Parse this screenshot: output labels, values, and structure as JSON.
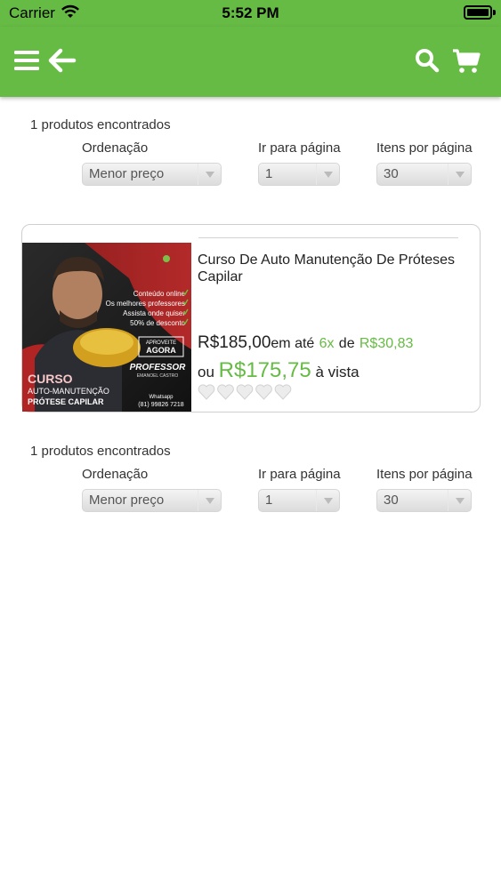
{
  "status_bar": {
    "carrier": "Carrier",
    "time": "5:52 PM"
  },
  "nav": {
    "icons": [
      "menu-icon",
      "back-arrow-icon",
      "search-icon",
      "cart-icon"
    ],
    "color": "#66bb44"
  },
  "top_controls": {
    "results": "1 produtos encontrados",
    "sort_label": "Ordenação",
    "sort_value": "Menor preço",
    "page_label": "Ir para página",
    "page_value": "1",
    "per_page_label": "Itens por página",
    "per_page_value": "30"
  },
  "product": {
    "title": "Curso De Auto Manutenção De Próteses Capilar",
    "price": "R$185,00",
    "installment_prefix": "em até",
    "installments": "6x",
    "installment_of": "de",
    "installment_value": "R$30,83",
    "cash_prefix": "ou",
    "cash_price": "R$175,75",
    "cash_suffix": "à vista",
    "rating": 0,
    "rating_max": 5,
    "image": {
      "bullets": [
        "Conteúdo online",
        "Os melhores professores",
        "Assista onde quiser",
        "50% de desconto"
      ],
      "badge_line1": "APROVEITE",
      "badge_line2": "AGORA",
      "professor": "PROFESSOR",
      "professor_name": "EMANOEL CASTRO",
      "curso": "CURSO",
      "subtitle1": "AUTO-MANUTENÇÃO",
      "subtitle2": "PRÓTESE CAPILAR",
      "whatsapp_label": "Whatsapp",
      "whatsapp_number": "(81) 99826 7218"
    }
  },
  "bottom_controls": {
    "results": "1 produtos encontrados",
    "sort_label": "Ordenação",
    "sort_value": "Menor preço",
    "page_label": "Ir para página",
    "page_value": "1",
    "per_page_label": "Itens por página",
    "per_page_value": "30"
  }
}
